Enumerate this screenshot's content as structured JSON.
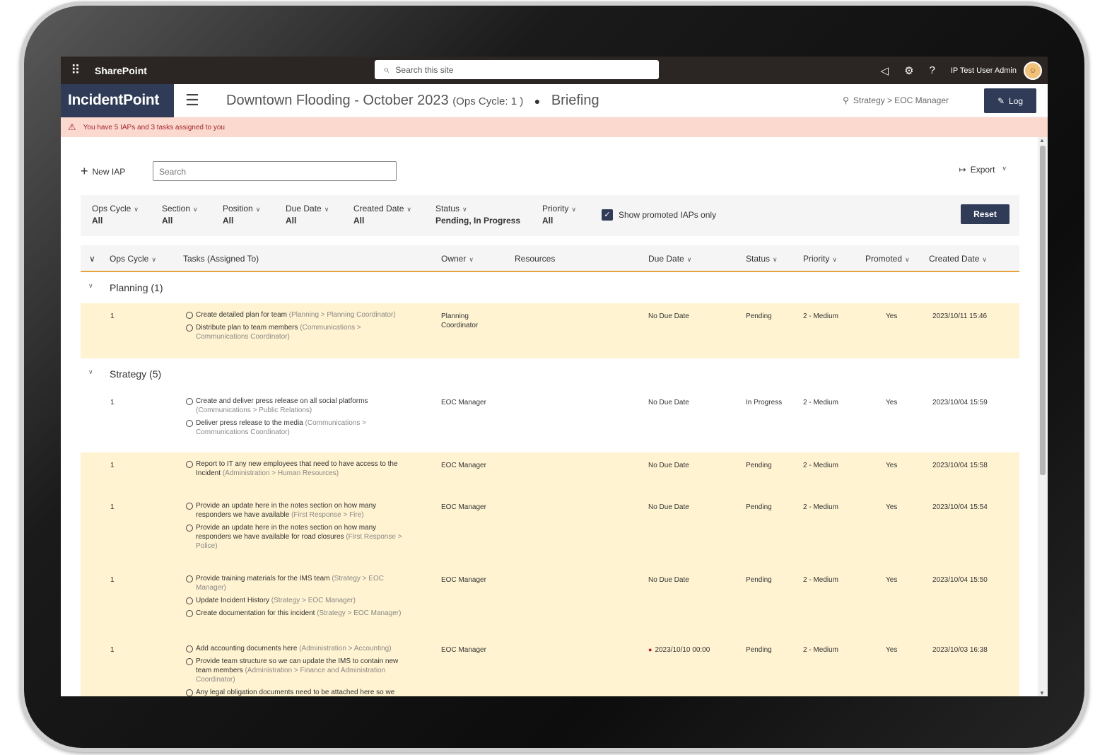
{
  "sharepoint": {
    "app_name": "SharePoint",
    "search_placeholder": "Search this site",
    "user_name": "IP Test User Admin"
  },
  "app": {
    "logo_text": "IncidentPoint",
    "incident_title": "Downtown Flooding - October 2023",
    "ops_cycle": "(Ops Cycle: 1 )",
    "view": "Briefing",
    "role": "Strategy > EOC Manager",
    "log_label": "Log"
  },
  "alert": {
    "text": "You have 5 IAPs and 3 tasks assigned to you"
  },
  "toolbar": {
    "new_iap_label": "New IAP",
    "search_placeholder": "Search",
    "export_label": "Export"
  },
  "filters": {
    "items": [
      {
        "label": "Ops Cycle",
        "value": "All"
      },
      {
        "label": "Section",
        "value": "All"
      },
      {
        "label": "Position",
        "value": "All"
      },
      {
        "label": "Due Date",
        "value": "All"
      },
      {
        "label": "Created Date",
        "value": "All"
      },
      {
        "label": "Status",
        "value": "Pending, In Progress"
      },
      {
        "label": "Priority",
        "value": "All"
      }
    ],
    "promoted_only_label": "Show promoted IAPs only",
    "promoted_only_checked": true,
    "reset_label": "Reset"
  },
  "columns": {
    "ops_cycle": "Ops Cycle",
    "tasks": "Tasks (Assigned To)",
    "owner": "Owner",
    "resources": "Resources",
    "due_date": "Due Date",
    "status": "Status",
    "priority": "Priority",
    "promoted": "Promoted",
    "created_date": "Created Date"
  },
  "groups": [
    {
      "title": "Planning (1)",
      "rows": [
        {
          "ops_cycle": "1",
          "tasks": [
            {
              "text": "Create detailed plan for team",
              "path": "(Planning > Planning Coordinator)"
            },
            {
              "text": "Distribute plan to team members",
              "path": "(Communications > Communications Coordinator)"
            }
          ],
          "owner": "Planning Coordinator",
          "due_date": "No Due Date",
          "status": "Pending",
          "priority": "2 - Medium",
          "promoted": "Yes",
          "created_date": "2023/10/11 15:46"
        }
      ]
    },
    {
      "title": "Strategy (5)",
      "rows": [
        {
          "ops_cycle": "1",
          "tasks": [
            {
              "text": "Create and deliver press release on all social platforms",
              "path": "(Communications > Public Relations)"
            },
            {
              "text": "Deliver press release to the media",
              "path": "(Communications > Communications Coordinator)"
            }
          ],
          "owner": "EOC Manager",
          "due_date": "No Due Date",
          "status": "In Progress",
          "priority": "2 - Medium",
          "promoted": "Yes",
          "created_date": "2023/10/04 15:59"
        },
        {
          "ops_cycle": "1",
          "tasks": [
            {
              "text": "Report to IT any new employees that need to have access to the Incident",
              "path": "(Administration > Human Resources)"
            }
          ],
          "owner": "EOC Manager",
          "due_date": "No Due Date",
          "status": "Pending",
          "priority": "2 - Medium",
          "promoted": "Yes",
          "created_date": "2023/10/04 15:58"
        },
        {
          "ops_cycle": "1",
          "tasks": [
            {
              "text": "Provide an update here in the notes section on how many responders we have available",
              "path": "(First Response > Fire)"
            },
            {
              "text": "Provide an update here in the notes section on how many responders we have available for road closures",
              "path": "(First Response > Police)"
            }
          ],
          "owner": "EOC Manager",
          "due_date": "No Due Date",
          "status": "Pending",
          "priority": "2 - Medium",
          "promoted": "Yes",
          "created_date": "2023/10/04 15:54"
        },
        {
          "ops_cycle": "1",
          "tasks": [
            {
              "text": "Provide training materials for the IMS team",
              "path": "(Strategy > EOC Manager)"
            },
            {
              "text": "Update Incident History",
              "path": "(Strategy > EOC Manager)"
            },
            {
              "text": "Create documentation for this incident",
              "path": "(Strategy > EOC Manager)"
            }
          ],
          "owner": "EOC Manager",
          "due_date": "No Due Date",
          "status": "Pending",
          "priority": "2 - Medium",
          "promoted": "Yes",
          "created_date": "2023/10/04 15:50"
        },
        {
          "ops_cycle": "1",
          "tasks": [
            {
              "text": "Add accounting documents here",
              "path": "(Administration > Accounting)"
            },
            {
              "text": "Provide team structure so we can update the IMS to contain new team members",
              "path": "(Administration > Finance and Administration Coordinator)"
            },
            {
              "text": "Any legal obligation documents need to be attached here so we",
              "path": ""
            }
          ],
          "owner": "EOC Manager",
          "due_date": "2023/10/10 00:00",
          "due_overdue": true,
          "status": "Pending",
          "priority": "2 - Medium",
          "promoted": "Yes",
          "created_date": "2023/10/03 16:38"
        }
      ]
    }
  ],
  "colors": {
    "header_dark": "#2b2623",
    "brand_navy": "#2f3b57",
    "alert_bg": "#fcd9cf",
    "row_highlight": "#fff3d1",
    "accent_orange": "#e8a33d"
  }
}
